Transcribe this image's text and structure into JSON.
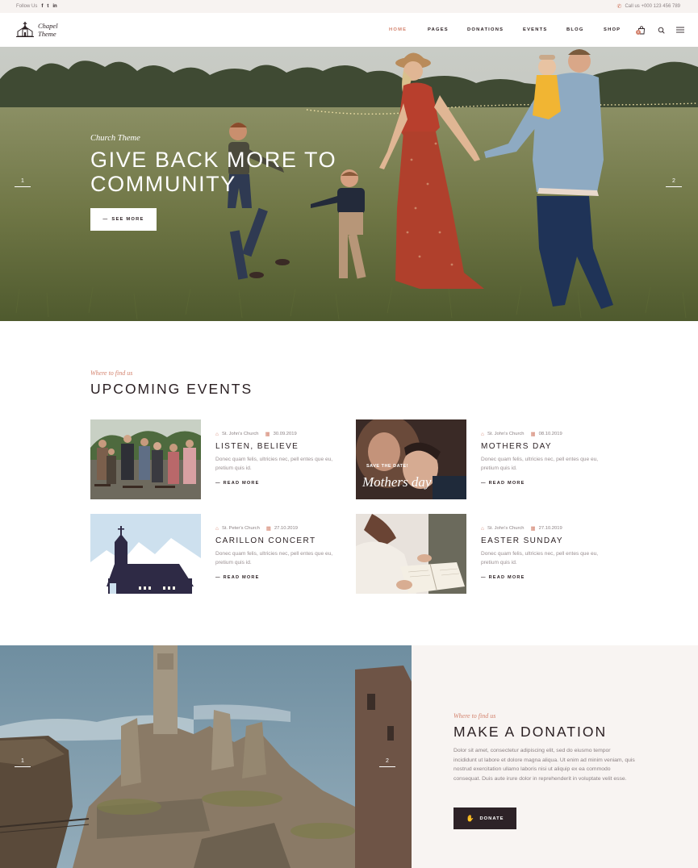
{
  "topbar": {
    "follow_label": "Follow Us",
    "social": [
      "f",
      "t",
      "in"
    ],
    "call_label": "Call us +000 123 456 789"
  },
  "brand": {
    "line1": "Chapel",
    "line2": "Theme"
  },
  "nav": {
    "items": [
      {
        "label": "HOME",
        "active": true
      },
      {
        "label": "PAGES",
        "active": false
      },
      {
        "label": "DONATIONS",
        "active": false
      },
      {
        "label": "EVENTS",
        "active": false
      },
      {
        "label": "BLOG",
        "active": false
      },
      {
        "label": "SHOP",
        "active": false
      }
    ],
    "cart_count": "0"
  },
  "hero": {
    "subtitle": "Church Theme",
    "title": "GIVE BACK MORE TO COMMUNITY",
    "button": "SEE MORE",
    "slide_prev": "1",
    "slide_next": "2"
  },
  "events": {
    "subtitle": "Where to find us",
    "title": "UPCOMING EVENTS",
    "items": [
      {
        "location": "St. John's Church",
        "date": "30.09.2019",
        "title": "LISTEN, BELIEVE",
        "desc": "Donec quam felis, ultricies nec, pell entes que eu, pretium quis id.",
        "more": "READ MORE"
      },
      {
        "location": "St. John's Church",
        "date": "08.10.2019",
        "title": "MOTHERS DAY",
        "desc": "Donec quam felis, ultricies nec, pell entes que eu, pretium quis id.",
        "more": "READ MORE",
        "img_text1": "SAVE THE DATE!",
        "img_text2": "Mothers day"
      },
      {
        "location": "St. Peter's Church",
        "date": "27.10.2019",
        "title": "CARILLON CONCERT",
        "desc": "Donec quam felis, ultricies nec, pell entes que eu, pretium quis id.",
        "more": "READ MORE"
      },
      {
        "location": "St. John's Church",
        "date": "27.10.2019",
        "title": "EASTER SUNDAY",
        "desc": "Donec quam felis, ultricies nec, pell entes que eu, pretium quis id.",
        "more": "READ MORE"
      }
    ]
  },
  "donation": {
    "subtitle": "Where to find us",
    "title": "MAKE A DONATION",
    "text": "Dolor sit amet, consectetur adipiscing elit, sed do eiusmo tempor incididunt ut labore et dolore magna aliqua. Ut enim ad minim veniam, quis nostrud exercitation ullamo laboris nisi ut aliquip ex ea commodo consequat. Duis aute irure dolor in reprehenderit in voluptate velit esse.",
    "button": "DONATE",
    "slide_prev": "1",
    "slide_next": "2"
  },
  "colors": {
    "accent": "#d3826d",
    "dark": "#2d2227",
    "panel": "#f8f4f2"
  }
}
